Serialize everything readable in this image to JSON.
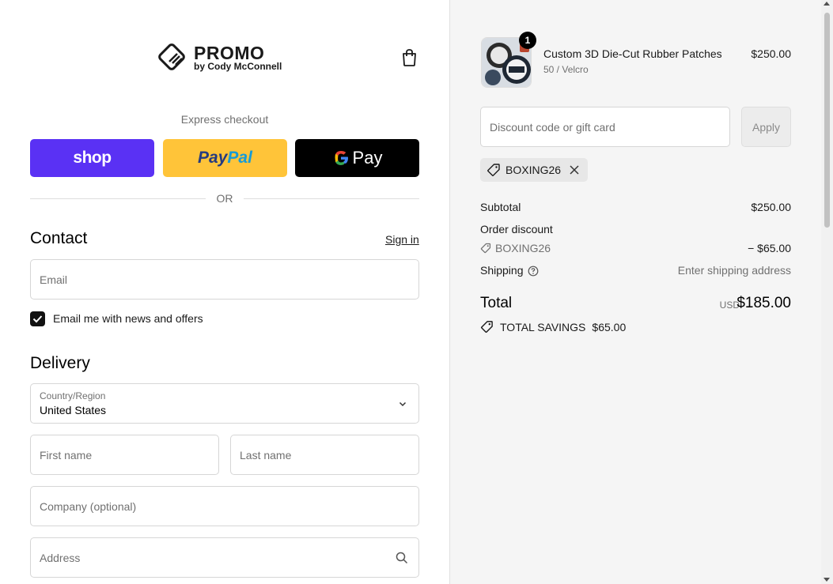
{
  "brand": {
    "title": "PROMO",
    "subtitle": "by Cody McConnell"
  },
  "express": {
    "label": "Express checkout",
    "shop_label": "shop",
    "paypal_label_1": "Pay",
    "paypal_label_2": "Pal",
    "gpay_g": "G",
    "gpay_label": "Pay",
    "or_text": "OR"
  },
  "contact": {
    "heading": "Contact",
    "signin": "Sign in",
    "email_placeholder": "Email",
    "newsletter_label": "Email me with news and offers",
    "newsletter_checked": true
  },
  "delivery": {
    "heading": "Delivery",
    "country_label": "Country/Region",
    "country_value": "United States",
    "first_name_placeholder": "First name",
    "last_name_placeholder": "Last name",
    "company_placeholder": "Company (optional)",
    "address_placeholder": "Address"
  },
  "cart": {
    "item": {
      "quantity": "1",
      "title": "Custom 3D Die-Cut Rubber Patches",
      "variant": "50 / Velcro",
      "price": "$250.00"
    },
    "discount_placeholder": "Discount code or gift card",
    "apply_label": "Apply",
    "applied_code": "BOXING26",
    "subtotal_label": "Subtotal",
    "subtotal_value": "$250.00",
    "order_discount_label": "Order discount",
    "discount_code": "BOXING26",
    "discount_value": "− $65.00",
    "shipping_label": "Shipping",
    "shipping_value": "Enter shipping address",
    "total_label": "Total",
    "total_currency": "USD",
    "total_value": "$185.00",
    "savings_label": "TOTAL SAVINGS",
    "savings_value": "$65.00"
  },
  "colors": {
    "shop_pay": "#5a31f4",
    "paypal": "#ffc439",
    "gpay": "#000000",
    "summary_bg": "#f5f5f5"
  }
}
